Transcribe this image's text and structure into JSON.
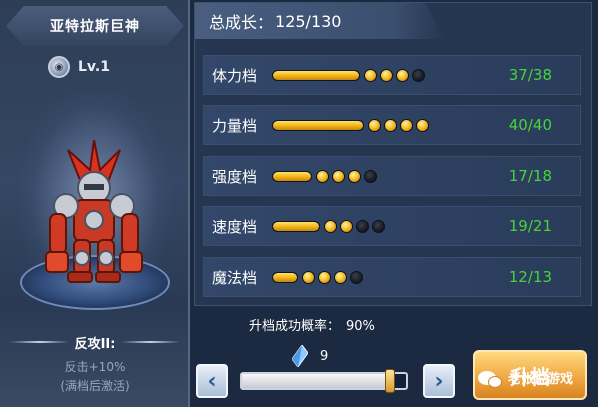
{
  "character": {
    "name": "亚特拉斯巨神",
    "level": "Lv.1"
  },
  "skill": {
    "title": "反攻II:",
    "effect": "反击+10%",
    "note": "(满档后激活)"
  },
  "growth": {
    "label": "总成长：",
    "value": "125/130"
  },
  "stats": [
    {
      "label": "体力档",
      "value": "37/38",
      "fill": 0.5,
      "pips_on": 3,
      "pips_total": 4
    },
    {
      "label": "力量档",
      "value": "40/40",
      "fill": 0.5,
      "pips_on": 4,
      "pips_total": 4
    },
    {
      "label": "强度档",
      "value": "17/18",
      "fill": 0.25,
      "pips_on": 3,
      "pips_total": 4
    },
    {
      "label": "速度档",
      "value": "19/21",
      "fill": 0.25,
      "pips_on": 2,
      "pips_total": 4
    },
    {
      "label": "魔法档",
      "value": "12/13",
      "fill": 0.15,
      "pips_on": 3,
      "pips_total": 4
    }
  ],
  "upgrade": {
    "rate_label": "升档成功概率：",
    "rate_value": "90%",
    "crystal_count": "9",
    "slider_level": 0.9,
    "button_label": "升档"
  },
  "watermark": {
    "text": "老张说游戏"
  },
  "colors": {
    "stat_value": "#46d33c",
    "bar_fill": "#f0b116",
    "button": "#f0a844"
  },
  "icons": {
    "level": "level-orb-icon",
    "crystal": "crystal-icon",
    "prev": "chevron-left-icon",
    "next": "chevron-right-icon"
  }
}
